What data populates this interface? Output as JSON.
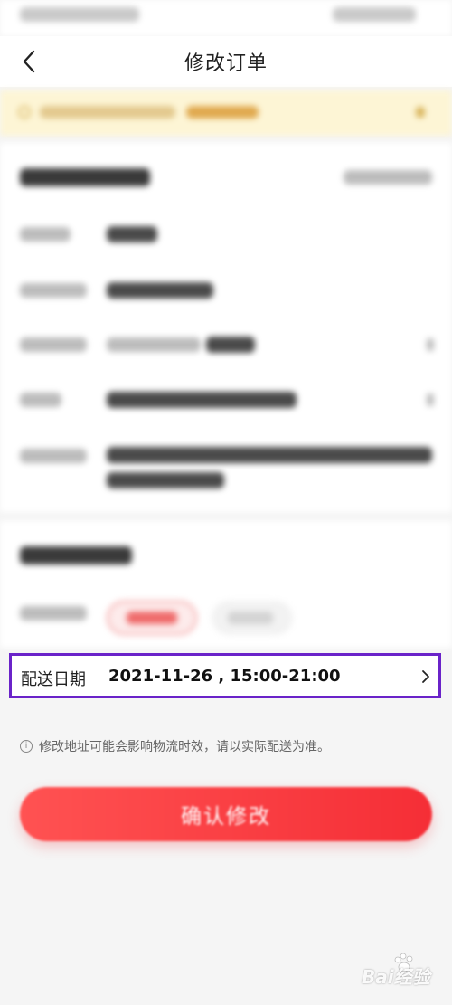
{
  "header": {
    "title": "修改订单"
  },
  "delivery": {
    "date_label": "配送日期",
    "date_value": "2021-11-26 , 15:00-21:00"
  },
  "hint": {
    "text": "修改地址可能会影响物流时效，请以实际配送为准。"
  },
  "confirm": {
    "label": "确认修改"
  },
  "watermark": {
    "text": "Bai经验"
  },
  "colors": {
    "accent_red": "#f52e36",
    "highlight_box": "#6a23c9",
    "notice_bg": "#fdf5d5"
  },
  "icons": {
    "back": "chevron-left-icon",
    "date_arrow": "chevron-right-icon",
    "hint": "info-circle-icon",
    "watermark": "paw-icon"
  }
}
